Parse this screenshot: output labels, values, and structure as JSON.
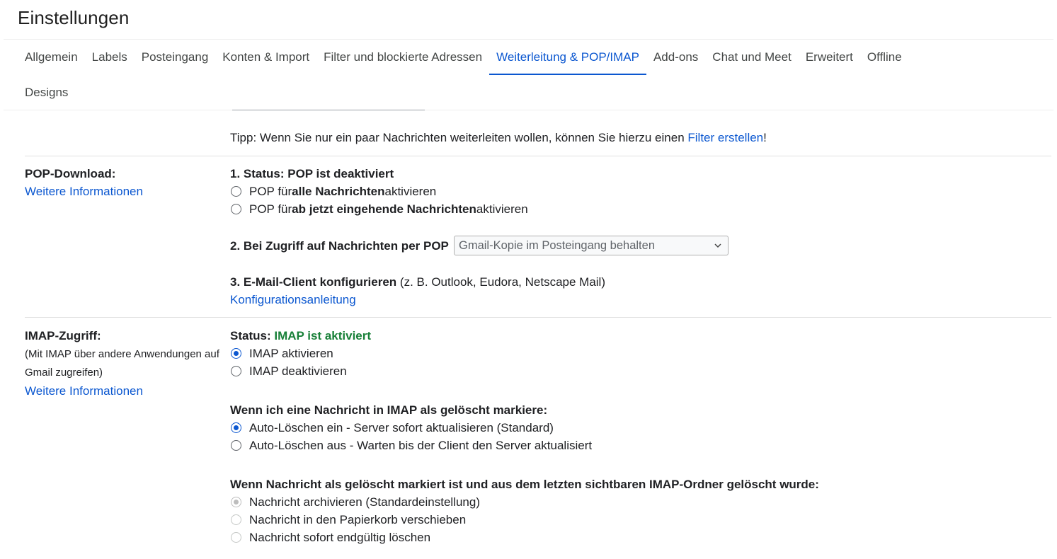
{
  "header": {
    "title": "Einstellungen"
  },
  "tabs": [
    {
      "label": "Allgemein"
    },
    {
      "label": "Labels"
    },
    {
      "label": "Posteingang"
    },
    {
      "label": "Konten & Import"
    },
    {
      "label": "Filter und blockierte Adressen"
    },
    {
      "label": "Weiterleitung & POP/IMAP",
      "active": true
    },
    {
      "label": "Add-ons"
    },
    {
      "label": "Chat und Meet"
    },
    {
      "label": "Erweitert"
    },
    {
      "label": "Offline"
    },
    {
      "label": "Designs"
    }
  ],
  "forwarding": {
    "tip_prefix": "Tipp: Wenn Sie nur ein paar Nachrichten weiterleiten wollen, können Sie hierzu einen ",
    "tip_link": "Filter erstellen",
    "tip_suffix": "!"
  },
  "pop": {
    "section_label": "POP-Download:",
    "more_info": "Weitere Informationen",
    "status_text": "1. Status: POP ist deaktiviert",
    "option_all": {
      "pre": "POP für ",
      "bold": "alle Nachrichten",
      "post": " aktivieren"
    },
    "option_new": {
      "pre": "POP für ",
      "bold": "ab jetzt eingehende Nachrichten",
      "post": " aktivieren"
    },
    "access_label": "2. Bei Zugriff auf Nachrichten per POP",
    "access_select_value": "Gmail-Kopie im Posteingang behalten",
    "client_bold": "3. E-Mail-Client konfigurieren",
    "client_rest": " (z. B. Outlook, Eudora, Netscape Mail)",
    "config_link": "Konfigurationsanleitung"
  },
  "imap": {
    "section_label": "IMAP-Zugriff:",
    "desc_line1": "(Mit IMAP über andere Anwendungen auf",
    "desc_line2": "Gmail zugreifen)",
    "more_info": "Weitere Informationen",
    "status_label": "Status: ",
    "status_value": "IMAP ist aktiviert",
    "enable": "IMAP aktivieren",
    "disable": "IMAP deaktivieren",
    "deleted_heading": "Wenn ich eine Nachricht in IMAP als gelöscht markiere:",
    "autoexpunge_on": "Auto-Löschen ein - Server sofort aktualisieren (Standard)",
    "autoexpunge_off": "Auto-Löschen aus - Warten bis der Client den Server aktualisiert",
    "expunged_heading": "Wenn Nachricht als gelöscht markiert ist und aus dem letzten sichtbaren IMAP-Ordner gelöscht wurde:",
    "archive": "Nachricht archivieren (Standardeinstellung)",
    "trash": "Nachricht in den Papierkorb verschieben",
    "delete_forever": "Nachricht sofort endgültig löschen"
  },
  "colors": {
    "accent": "#0b57d0",
    "status_green": "#188038"
  }
}
